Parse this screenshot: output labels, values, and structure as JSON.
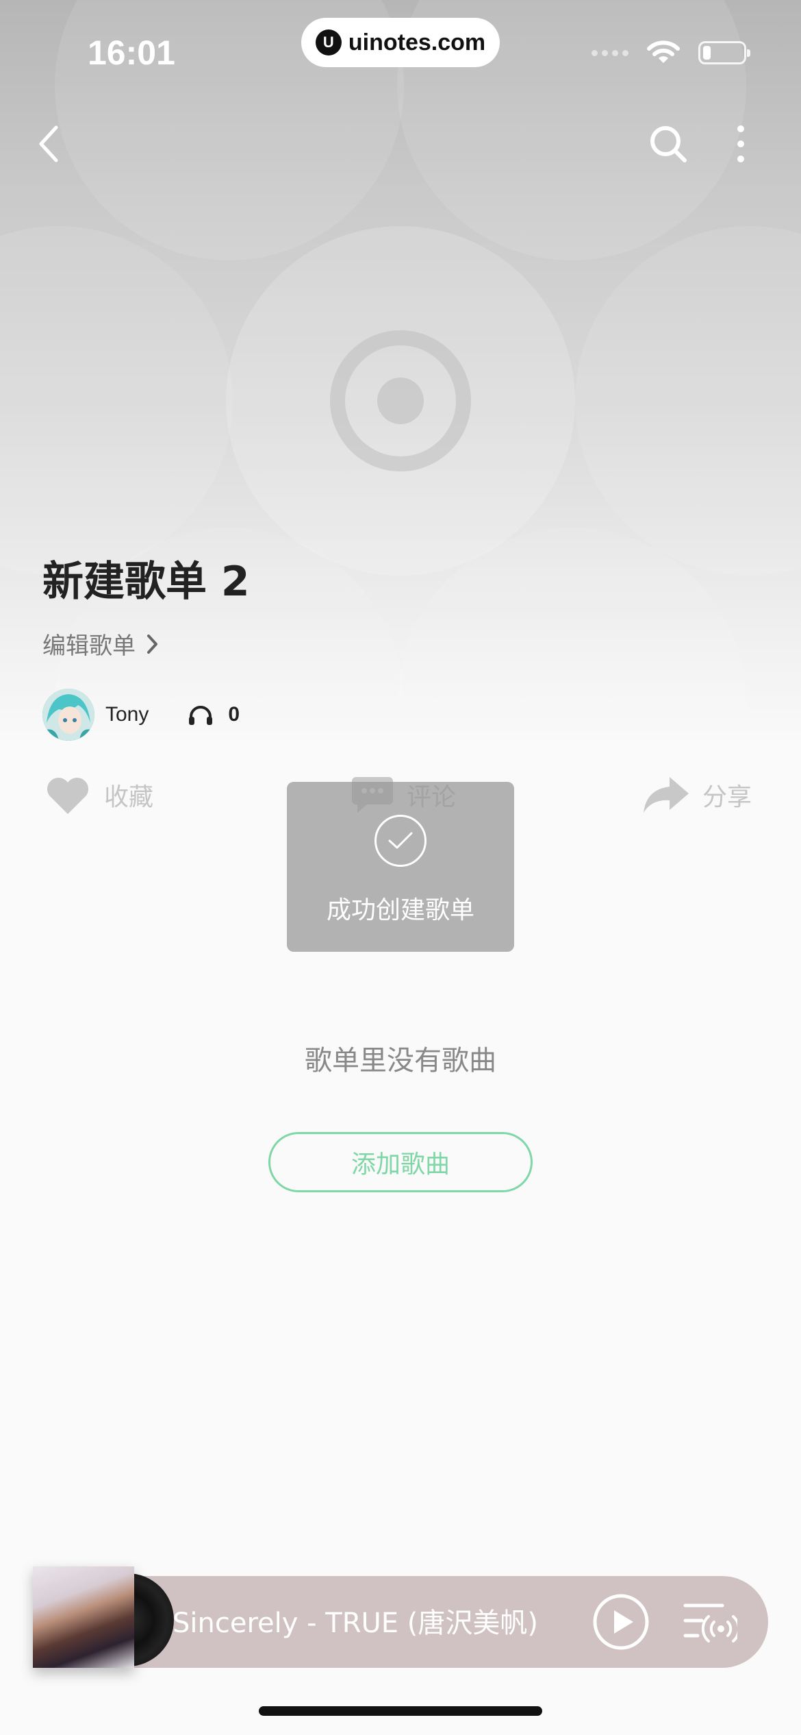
{
  "status_bar": {
    "time": "16:01",
    "url": "uinotes.com",
    "url_logo": "U",
    "battery_level": 0.2
  },
  "nav": {
    "back_icon": "chevron-left-icon",
    "search_icon": "search-icon",
    "more_icon": "more-vertical-icon"
  },
  "playlist": {
    "title": "新建歌单 2",
    "edit_label": "编辑歌单",
    "creator_name": "Tony",
    "play_count": "0"
  },
  "actions": {
    "favorite_label": "收藏",
    "comment_label": "评论",
    "share_label": "分享"
  },
  "toast": {
    "message": "成功创建歌单"
  },
  "empty_state": {
    "message": "歌单里没有歌曲",
    "add_button_label": "添加歌曲"
  },
  "mini_player": {
    "track": "Sincerely - TRUE (唐沢美帆)"
  },
  "colors": {
    "accent_green": "#7fd6a6",
    "player_bg": "#d0c2c2",
    "title_text": "#222222"
  }
}
